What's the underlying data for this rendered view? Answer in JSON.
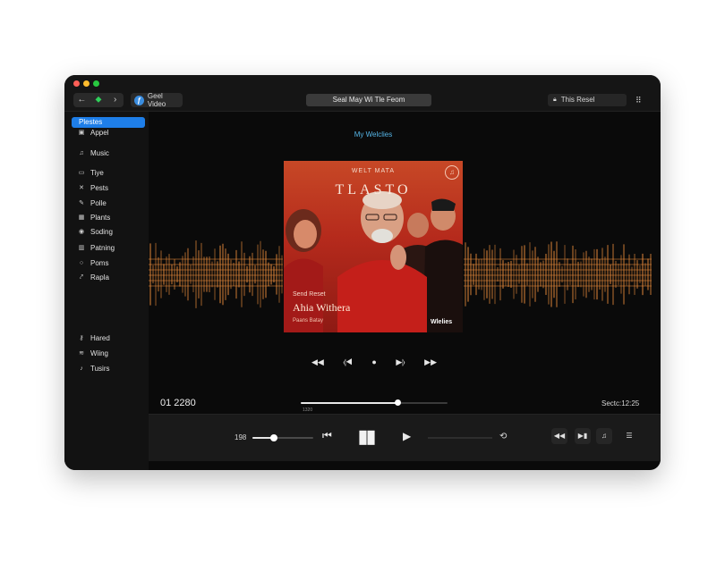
{
  "window": {
    "nav": {
      "back": "←",
      "forward": "›"
    },
    "source_label": "Geel Video",
    "title": "Seal May Wi Tle Feom",
    "search_text": "This Resel"
  },
  "sidebar": {
    "items": [
      {
        "label": "Plestes",
        "icon": "playlist-icon",
        "active": true
      },
      {
        "label": "Appel",
        "icon": "app-icon"
      },
      {
        "label": "Music",
        "icon": "music-icon"
      },
      {
        "label": "Tiye",
        "icon": "tv-icon"
      },
      {
        "label": "Pests",
        "icon": "podcast-icon"
      },
      {
        "label": "Polle",
        "icon": "pen-icon"
      },
      {
        "label": "Plants",
        "icon": "grid-icon"
      },
      {
        "label": "Soding",
        "icon": "disc-icon"
      },
      {
        "label": "Patning",
        "icon": "chart-icon"
      },
      {
        "label": "Poms",
        "icon": "circle-icon"
      },
      {
        "label": "Rapla",
        "icon": "link-icon"
      },
      {
        "label": "Hared",
        "icon": "key-icon"
      },
      {
        "label": "Wiing",
        "icon": "wave-icon"
      },
      {
        "label": "Tusirs",
        "icon": "note-icon"
      }
    ]
  },
  "main": {
    "section_title": "My Welclies",
    "album": {
      "top_text": "WELT MATA",
      "title": "TLASTO",
      "subtitle": "Send Reset",
      "artist": "Ahia Withera",
      "small_text": "Paans Batay",
      "label": "Wlelies"
    },
    "time_left": "01 2280",
    "time_right": "Sectc:12:25",
    "scrub_label": "1320",
    "progress": 0.66
  },
  "player": {
    "volume_label": "198",
    "volume": 0.35
  },
  "colors": {
    "accent": "#1e7ee8",
    "wave": "#e88a3a",
    "album_red": "#b52a1c"
  }
}
